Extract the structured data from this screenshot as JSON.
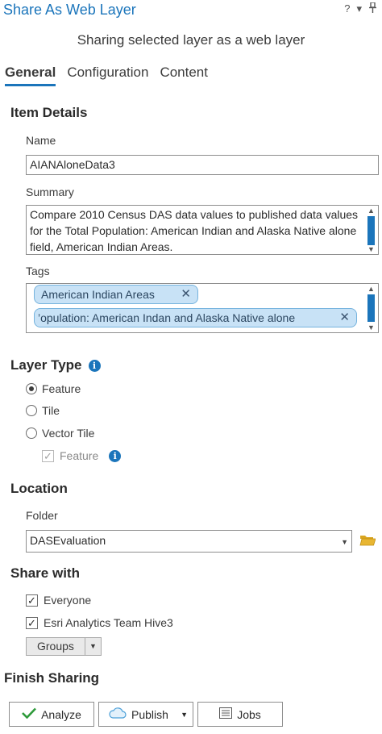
{
  "window": {
    "title": "Share As Web Layer",
    "help_glyph": "?",
    "menu_glyph": "▾",
    "pin_glyph": "⚐"
  },
  "subtitle": "Sharing selected layer as a web layer",
  "tabs": [
    {
      "label": "General",
      "active": true
    },
    {
      "label": "Configuration",
      "active": false
    },
    {
      "label": "Content",
      "active": false
    }
  ],
  "item_details": {
    "heading": "Item Details",
    "name_label": "Name",
    "name_value": "AIANAloneData3",
    "summary_label": "Summary",
    "summary_value": "Compare 2010 Census DAS data values to published data values for the Total Population: American Indian and Alaska Native alone field, American Indian Areas.",
    "tags_label": "Tags",
    "tags": [
      "American Indian Areas",
      "Population: American Indan and Alaska Native alone"
    ],
    "tag_display": [
      "American Indian Areas",
      "’opulation: American Indan and Alaska Native alone"
    ]
  },
  "layer_type": {
    "heading": "Layer Type",
    "options": [
      {
        "label": "Feature",
        "selected": true
      },
      {
        "label": "Tile",
        "selected": false
      },
      {
        "label": "Vector Tile",
        "selected": false
      }
    ],
    "sub_option": {
      "label": "Feature",
      "checked": true,
      "enabled": false
    }
  },
  "location": {
    "heading": "Location",
    "folder_label": "Folder",
    "folder_value": "DASEvaluation"
  },
  "share_with": {
    "heading": "Share with",
    "options": [
      {
        "label": "Everyone",
        "checked": true
      },
      {
        "label": "Esri Analytics Team Hive3",
        "checked": true
      }
    ],
    "groups_label": "Groups"
  },
  "finish": {
    "heading": "Finish Sharing",
    "analyze_label": "Analyze",
    "publish_label": "Publish",
    "jobs_label": "Jobs"
  },
  "colors": {
    "accent": "#1b75bb",
    "tag_fill": "#c8e2f6",
    "check_green": "#2e9a3a",
    "folder_yellow": "#e8b632"
  },
  "icons": [
    "help-icon",
    "menu-icon",
    "pin-icon",
    "info-icon",
    "folder-icon",
    "check-icon",
    "cloud-icon",
    "jobs-list-icon",
    "close-icon",
    "chevron-down-icon"
  ]
}
